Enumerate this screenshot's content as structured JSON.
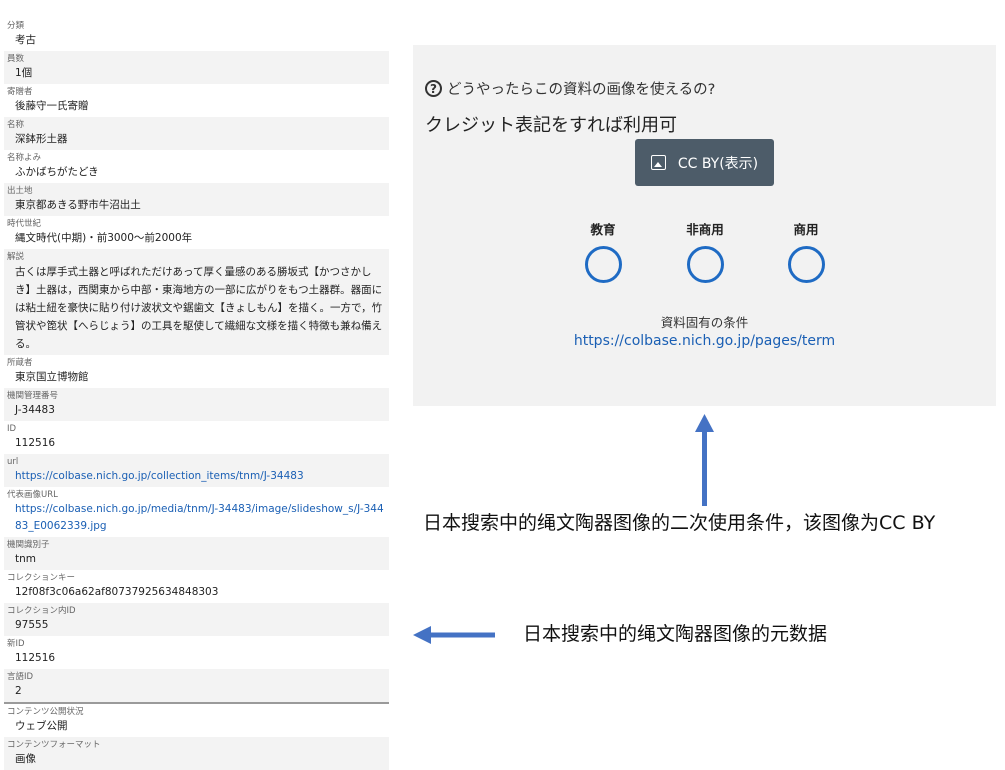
{
  "metadata": [
    {
      "label": "分類",
      "value": "考古"
    },
    {
      "label": "員数",
      "value": "1個"
    },
    {
      "label": "寄贈者",
      "value": "後藤守一氏寄贈"
    },
    {
      "label": "名称",
      "value": "深鉢形土器"
    },
    {
      "label": "名称よみ",
      "value": "ふかばちがたどき"
    },
    {
      "label": "出土地",
      "value": "東京都あきる野市牛沼出土"
    },
    {
      "label": "時代世紀",
      "value": "縄文時代(中期)・前3000～前2000年"
    },
    {
      "label": "解説",
      "value": "古くは厚手式土器と呼ばれただけあって厚く量感のある勝坂式【かつさかしき】土器は，西関東から中部・東海地方の一部に広がりをもつ土器群。器面には粘土紐を豪快に貼り付け波状文や鋸歯文【きょしもん】を描く。一方で，竹管状や箆状【へらじょう】の工具を駆使して繊細な文様を描く特徴も兼ね備える。"
    },
    {
      "label": "所蔵者",
      "value": "東京国立博物館"
    },
    {
      "label": "機関管理番号",
      "value": "J-34483"
    },
    {
      "label": "ID",
      "value": "112516"
    },
    {
      "label": "url",
      "value": "https://colbase.nich.go.jp/collection_items/tnm/J-34483"
    },
    {
      "label": "代表画像URL",
      "value": "https://colbase.nich.go.jp/media/tnm/J-34483/image/slideshow_s/J-34483_E0062339.jpg"
    },
    {
      "label": "機関識別子",
      "value": "tnm"
    },
    {
      "label": "コレクションキー",
      "value": "12f08f3c06a62af80737925634848303"
    },
    {
      "label": "コレクション内ID",
      "value": "97555"
    },
    {
      "label": "新ID",
      "value": "112516"
    },
    {
      "label": "言語ID",
      "value": "2"
    },
    {
      "label": "コンテンツ公開状況",
      "value": "ウェブ公開"
    },
    {
      "label": "コンテンツフォーマット",
      "value": "画像"
    }
  ],
  "license": {
    "question": "どうやったらこの資料の画像を使えるの?",
    "question_icon": "?",
    "credit_text": "クレジット表記をすれば利用可",
    "cc_button": "CC BY(表示)",
    "usage": [
      {
        "label": "教育",
        "allowed": true
      },
      {
        "label": "非商用",
        "allowed": true
      },
      {
        "label": "商用",
        "allowed": true
      }
    ],
    "conditions_label": "資料固有の条件",
    "conditions_url": "https://colbase.nich.go.jp/pages/term"
  },
  "annotations": {
    "license_note": "日本搜索中的绳文陶器图像的二次使用条件，该图像为CC BY",
    "metadata_note": "日本搜索中的绳文陶器图像的元数据"
  },
  "colors": {
    "arrow": "#4472c4",
    "link": "#1a5fb4",
    "button_bg": "#4d5c69",
    "circle": "#1f6bc4"
  }
}
